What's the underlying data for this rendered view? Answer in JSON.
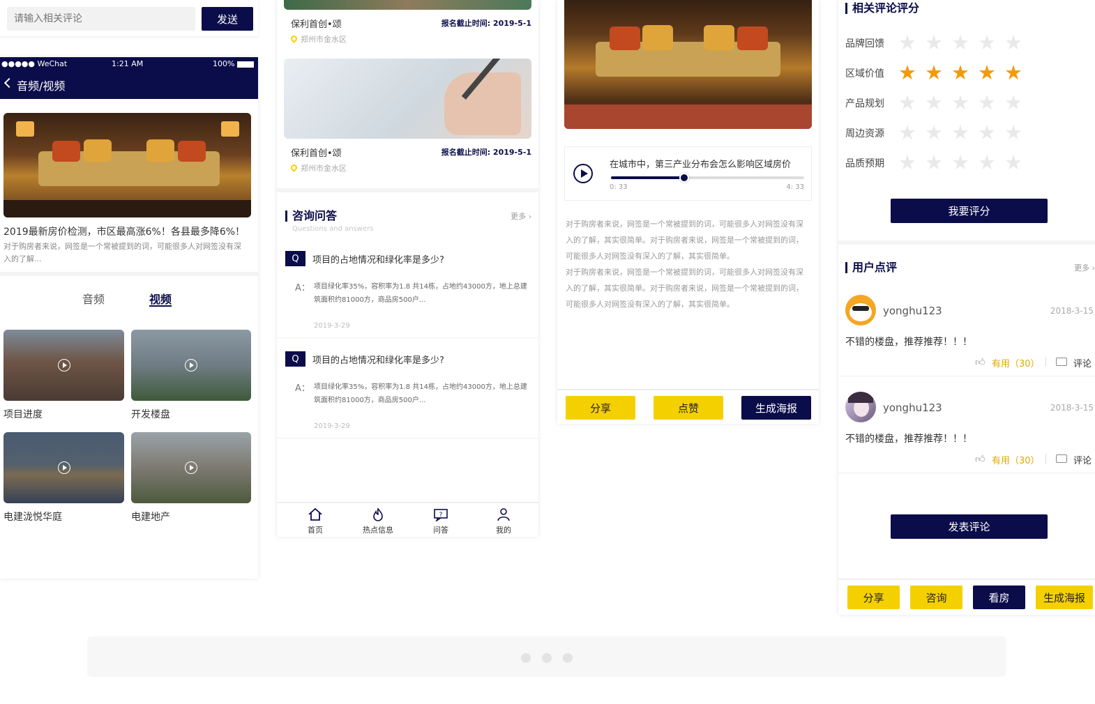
{
  "comment_bar": {
    "placeholder": "请输入相关评论",
    "send": "发送"
  },
  "phone1": {
    "status": {
      "carrier": "●●●●● WeChat",
      "time": "1:21 AM",
      "battery": "100%"
    },
    "title": "音频/视频",
    "headline": "2019最新房价检测，市区最高涨6%！各县最多降6%！",
    "desc": "对于购房者来说，网签是一个常被提到的词，可能很多人对网签没有深入的了解...",
    "tabs": [
      "音频",
      "视频"
    ],
    "videos": [
      "项目进度",
      "开发楼盘",
      "电建泷悦华庭",
      "电建地产"
    ]
  },
  "phone2": {
    "listings": [
      {
        "name": "保利首创•颂",
        "deadline": "报名截止时间: 2019-5-1",
        "loc": "郑州市金水区"
      },
      {
        "name": "保利首创•颂",
        "deadline": "报名截止时间: 2019-5-1",
        "loc": "郑州市金水区"
      }
    ],
    "qa_title": "咨询问答",
    "qa_sub": "Questions and answers",
    "more": "更多",
    "qa": [
      {
        "q": "项目的占地情况和绿化率是多少?",
        "a": "项目绿化率35%，容积率为1.8 共14栋，占地约43000方，地上总建筑面积约81000方，商品房500户...",
        "date": "2019-3-29"
      },
      {
        "q": "项目的占地情况和绿化率是多少?",
        "a": "项目绿化率35%，容积率为1.8 共14栋，占地约43000方，地上总建筑面积约81000方，商品房500户...",
        "date": "2019-3-29"
      }
    ],
    "nav": [
      "首页",
      "热点信息",
      "问答",
      "我的"
    ]
  },
  "phone3": {
    "audio_title": "在城市中，第三产业分布会怎么影响区域房价",
    "elapsed": "0: 33",
    "total": "4: 33",
    "progress": 0.38,
    "body": "对于购房者来说，网签是一个常被提到的词，可能很多人对网签没有深入的了解，其实很简单。对于购房者来说，网签是一个常被提到的词，可能很多人对网签没有深入的了解，其实很简单。\n对于购房者来说，网签是一个常被提到的词，可能很多人对网签没有深入的了解，其实很简单。对于购房者来说，网签是一个常被提到的词，可能很多人对网签没有深入的了解，其实很简单。",
    "buttons": [
      "分享",
      "点赞",
      "生成海报"
    ]
  },
  "phone4": {
    "rating_title": "相关评论评分",
    "ratings": [
      {
        "label": "品牌回馈",
        "stars": 0
      },
      {
        "label": "区域价值",
        "stars": 5
      },
      {
        "label": "产品规划",
        "stars": 0
      },
      {
        "label": "周边资源",
        "stars": 0
      },
      {
        "label": "品质预期",
        "stars": 0
      }
    ],
    "rate_btn": "我要评分",
    "review_title": "用户点评",
    "more": "更多",
    "reviews": [
      {
        "user": "yonghu123",
        "date": "2018-3-15",
        "text": "不错的楼盘，推荐推荐！！！",
        "useful": "有用（30）",
        "comment": "评论"
      },
      {
        "user": "yonghu123",
        "date": "2018-3-15",
        "text": "不错的楼盘，推荐推荐！！！",
        "useful": "有用（30）",
        "comment": "评论"
      }
    ],
    "post_btn": "发表评论",
    "buttons": [
      "分享",
      "咨询",
      "看房",
      "生成海报"
    ]
  },
  "colors": {
    "navy": "#0b0c4a",
    "yellow": "#f5d000",
    "star": "#f39a0b"
  }
}
